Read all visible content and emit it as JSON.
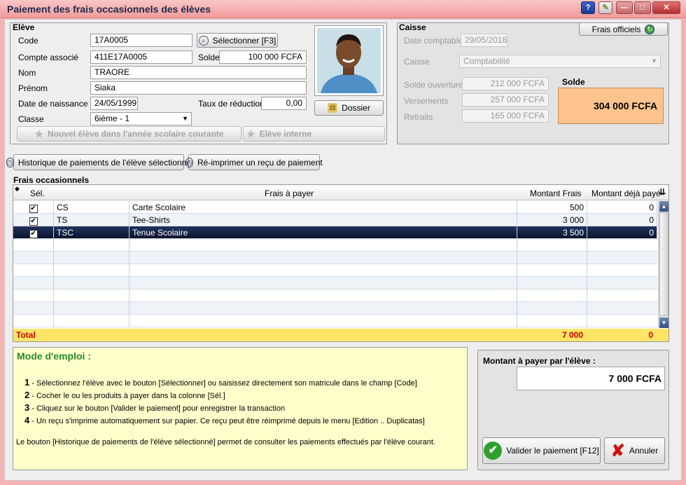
{
  "window": {
    "title": "Paiement des frais occasionnels des élèves"
  },
  "titlebar_buttons": {
    "help": "?",
    "minimize": "—",
    "maximize": "□",
    "close": "✕"
  },
  "eleve": {
    "group_title": "Elève",
    "code_label": "Code",
    "code_value": "17A0005",
    "select_button": "Sélectionner [F3]",
    "compte_label": "Compte associé",
    "compte_value": "411E17A0005",
    "solde_label": "Solde",
    "solde_value": "100 000 FCFA",
    "nom_label": "Nom",
    "nom_value": "TRAORE",
    "prenom_label": "Prénom",
    "prenom_value": "Siaka",
    "naissance_label": "Date de naissance",
    "naissance_value": "24/05/1999",
    "taux_label": "Taux de réduction",
    "taux_value": "0,00",
    "classe_label": "Classe",
    "classe_value": "6ième - 1",
    "dossier_button": "Dossier",
    "nouvel_button": "Nouvel élève dans l'année scolaire courante",
    "interne_button": "Elève interne"
  },
  "caisse": {
    "group_title": "Caisse",
    "frais_officiels_button": "Frais officiels",
    "date_label": "Date comptable",
    "date_value": "29/05/2018",
    "caisse_label": "Caisse",
    "caisse_value": "Comptabilité",
    "ouverture_label": "Solde ouverture",
    "ouverture_value": "212 000 FCFA",
    "versements_label": "Versements",
    "versements_value": "257 000 FCFA",
    "retraits_label": "Retraits",
    "retraits_value": "165 000 FCFA",
    "solde_title": "Solde",
    "solde_value": "304 000 FCFA"
  },
  "actions": {
    "historique_button": "Historique de paiements de l'élève sélectionné",
    "reimprimer_button": "Ré-imprimer un reçu de paiement"
  },
  "frais": {
    "section_title": "Frais occasionnels",
    "columns": {
      "sel": "Sél.",
      "frais": "Frais à payer",
      "montant": "Montant Frais",
      "paye": "Montant déjà payé"
    },
    "rows": [
      {
        "checked": "✔",
        "code": "CS",
        "label": "Carte Scolaire",
        "montant": "500",
        "paye": "0"
      },
      {
        "checked": "✔",
        "code": "TS",
        "label": "Tee-Shirts",
        "montant": "3 000",
        "paye": "0"
      },
      {
        "checked": "✔",
        "code": "TSC",
        "label": "Tenue Scolaire",
        "montant": "3 500",
        "paye": "0"
      }
    ],
    "total_label": "Total",
    "total_montant": "7 000",
    "total_paye": "0"
  },
  "help": {
    "title": "Mode d'emploi :",
    "steps": [
      {
        "num": "1",
        "text": " - Sélectionnez l'élève avec le bouton [Sélectionner] ou saisissez directement son matricule dans le champ [Code]"
      },
      {
        "num": "2",
        "text": " - Cocher le ou les produits à payer dans la colonne [Sél.]"
      },
      {
        "num": "3",
        "text": " - Cliquez sur le bouton [Valider le paiement] pour enregistrer la transaction"
      },
      {
        "num": "4",
        "text": " - Un reçu s'imprime automatiquement sur papier. Ce reçu peut être réimprimé depuis le menu [Edition .. Duplicatas]"
      }
    ],
    "footer": "Le bouton [Historique de paiements de l'élève sélectionné] permet de consulter les paiements effectués par l'élève courant."
  },
  "paiement": {
    "label": "Montant à payer par l'élève :",
    "value": "7 000 FCFA",
    "valider_button": "Valider le paiement [F12]",
    "annuler_button": "Annuler"
  },
  "colors": {
    "accent_red": "#d00000",
    "total_bg": "#ffe566",
    "solde_bg": "#fcc38e",
    "help_bg": "#ffffcc"
  }
}
